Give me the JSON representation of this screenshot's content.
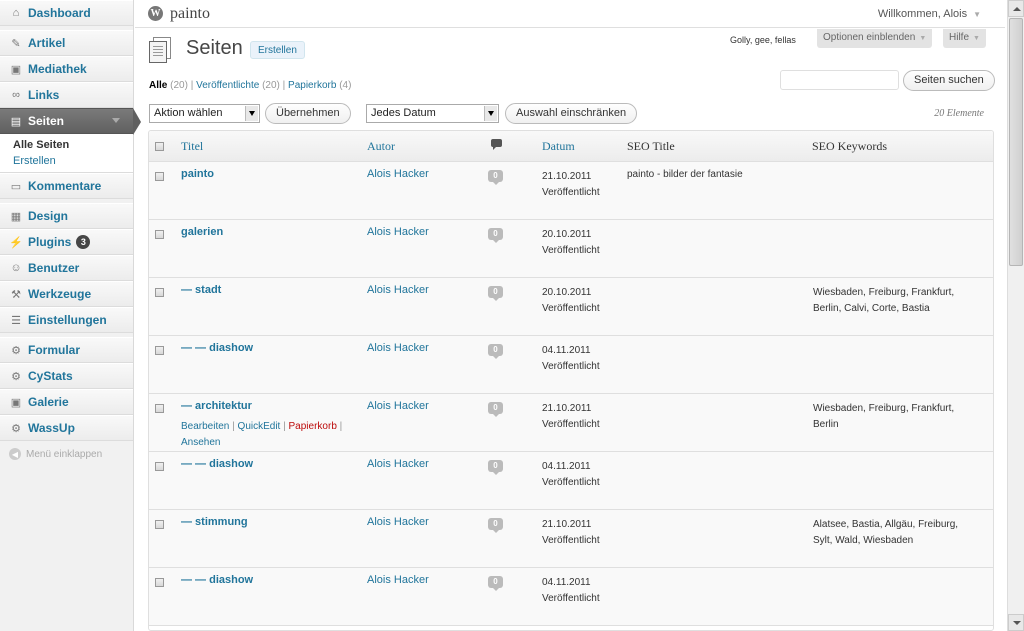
{
  "sidebar": {
    "items": [
      {
        "label": "Dashboard",
        "icon": "home-icon"
      },
      {
        "label": "Artikel",
        "icon": "pin-icon"
      },
      {
        "label": "Mediathek",
        "icon": "media-icon"
      },
      {
        "label": "Links",
        "icon": "link-icon"
      },
      {
        "label": "Seiten",
        "icon": "pages-icon"
      },
      {
        "label": "Kommentare",
        "icon": "comments-icon"
      },
      {
        "label": "Design",
        "icon": "appearance-icon"
      },
      {
        "label": "Plugins",
        "icon": "plugins-icon",
        "badge": "3"
      },
      {
        "label": "Benutzer",
        "icon": "users-icon"
      },
      {
        "label": "Werkzeuge",
        "icon": "tools-icon"
      },
      {
        "label": "Einstellungen",
        "icon": "settings-icon"
      },
      {
        "label": "Formular",
        "icon": "gear-icon"
      },
      {
        "label": "CyStats",
        "icon": "gear-icon"
      },
      {
        "label": "Galerie",
        "icon": "gallery-icon"
      },
      {
        "label": "WassUp",
        "icon": "gear-icon"
      }
    ],
    "submenu": [
      "Alle Seiten",
      "Erstellen"
    ],
    "collapse_label": "Menü einklappen"
  },
  "header": {
    "site_name": "painto",
    "welcome": "Willkommen, Alois",
    "tagline": "Golly, gee, fellas",
    "screen_options": "Optionen einblenden",
    "help": "Hilfe"
  },
  "page": {
    "title": "Seiten",
    "add_new": "Erstellen"
  },
  "filters": {
    "all_label": "Alle",
    "all_count": "(20)",
    "sep1": "|",
    "published_label": "Veröffentlichte",
    "published_count": "(20)",
    "sep2": "|",
    "trash_label": "Papierkorb",
    "trash_count": "(4)",
    "search_button": "Seiten suchen",
    "bulk_action": "Aktion wählen",
    "apply_button": "Übernehmen",
    "date_filter": "Jedes Datum",
    "filter_button": "Auswahl einschränken",
    "items_count": "20 Elemente"
  },
  "table": {
    "columns": {
      "title": "Titel",
      "author": "Autor",
      "date": "Datum",
      "seo_title": "SEO Title",
      "seo_keywords": "SEO Keywords"
    },
    "rows": [
      {
        "title": "painto",
        "author": "Alois Hacker",
        "comments": "0",
        "date": "21.10.2011",
        "status": "Veröffentlicht",
        "seo_title": "painto - bilder der fantasie",
        "kw1": "",
        "kw2": ""
      },
      {
        "title": "galerien",
        "author": "Alois Hacker",
        "comments": "0",
        "date": "20.10.2011",
        "status": "Veröffentlicht",
        "seo_title": "",
        "kw1": "",
        "kw2": ""
      },
      {
        "title": "— stadt",
        "author": "Alois Hacker",
        "comments": "0",
        "date": "20.10.2011",
        "status": "Veröffentlicht",
        "seo_title": "",
        "kw1": "Wiesbaden, Freiburg, Frankfurt,",
        "kw2": "Berlin, Calvi, Corte, Bastia"
      },
      {
        "title": "— — diashow",
        "author": "Alois Hacker",
        "comments": "0",
        "date": "04.11.2011",
        "status": "Veröffentlicht",
        "seo_title": "",
        "kw1": "",
        "kw2": ""
      },
      {
        "title": "— architektur",
        "author": "Alois Hacker",
        "comments": "0",
        "date": "21.10.2011",
        "status": "Veröffentlicht",
        "seo_title": "",
        "kw1": "Wiesbaden, Freiburg, Frankfurt,",
        "kw2": "Berlin",
        "actions": {
          "edit": "Bearbeiten",
          "quickedit": "QuickEdit",
          "trash": "Papierkorb",
          "view": "Ansehen",
          "sep": "|"
        }
      },
      {
        "title": "— — diashow",
        "author": "Alois Hacker",
        "comments": "0",
        "date": "04.11.2011",
        "status": "Veröffentlicht",
        "seo_title": "",
        "kw1": "",
        "kw2": ""
      },
      {
        "title": "— stimmung",
        "author": "Alois Hacker",
        "comments": "0",
        "date": "21.10.2011",
        "status": "Veröffentlicht",
        "seo_title": "",
        "kw1": "Alatsee, Bastia, Allgäu, Freiburg,",
        "kw2": "Sylt, Wald, Wiesbaden"
      },
      {
        "title": "— — diashow",
        "author": "Alois Hacker",
        "comments": "0",
        "date": "04.11.2011",
        "status": "Veröffentlicht",
        "seo_title": "",
        "kw1": "",
        "kw2": ""
      }
    ]
  }
}
